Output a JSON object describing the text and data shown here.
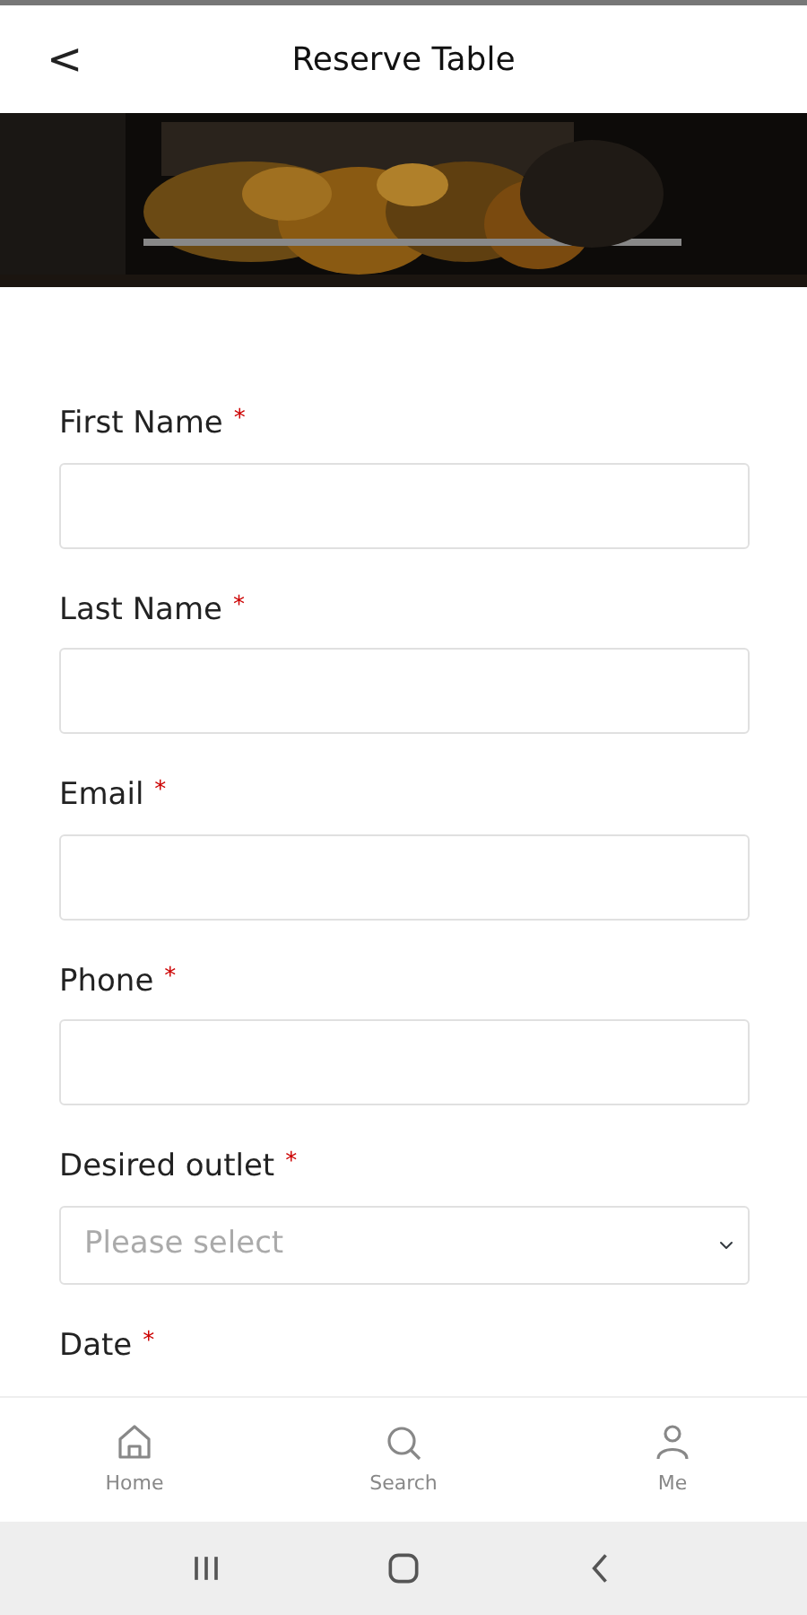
{
  "header": {
    "back": "<",
    "title": "Reserve Table"
  },
  "fields": [
    {
      "label": "First Name",
      "required_mark": "*",
      "kind": "text"
    },
    {
      "label": "Last Name",
      "required_mark": "*",
      "kind": "text"
    },
    {
      "label": "Email",
      "required_mark": "*",
      "kind": "text"
    },
    {
      "label": "Phone",
      "required_mark": "*",
      "kind": "text"
    },
    {
      "label": "Desired outlet",
      "required_mark": "*",
      "kind": "select",
      "placeholder": "Please select"
    },
    {
      "label": "Date",
      "required_mark": "*"
    }
  ],
  "bottom_nav": [
    {
      "label": "Home"
    },
    {
      "label": "Search"
    },
    {
      "label": "Me"
    }
  ]
}
